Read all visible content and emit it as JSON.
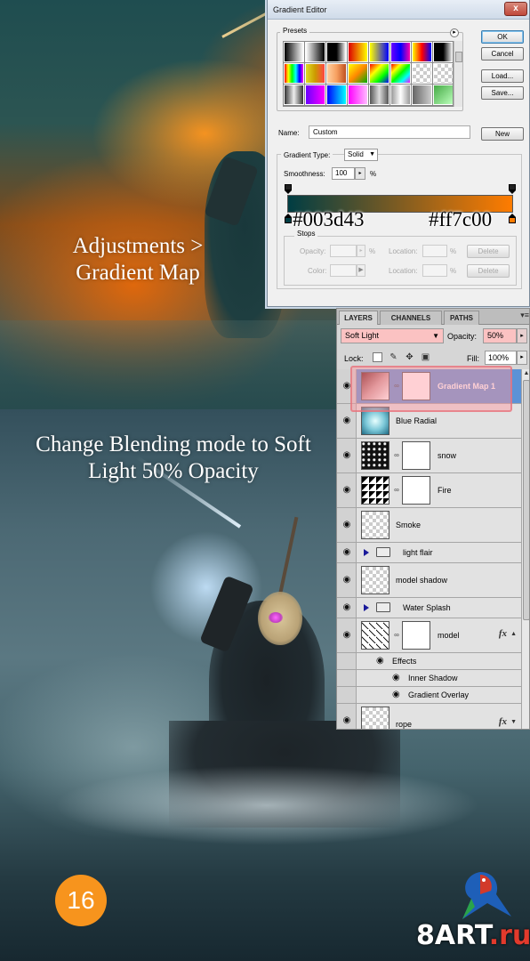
{
  "captions": {
    "top": "Adjustments > Gradient Map",
    "bottom": "Change Blending mode to Soft Light 50% Opacity"
  },
  "step_number": "16",
  "watermark": {
    "main": "8ART",
    "suffix": ".ru"
  },
  "colors": {
    "gradient_start": "#003d43",
    "gradient_end": "#ff7c00",
    "badge": "#f7941d",
    "blend_highlight": "#fbc2c2",
    "selected_layer": "#5b92d6"
  },
  "gradient_editor": {
    "title": "Gradient Editor",
    "close_glyph": "x",
    "presets_label": "Presets",
    "presets_menu_glyph": "▸",
    "buttons": {
      "ok": "OK",
      "cancel": "Cancel",
      "load": "Load...",
      "save": "Save...",
      "new": "New"
    },
    "name_label": "Name:",
    "name_value": "Custom",
    "gradient_type_label": "Gradient Type:",
    "gradient_type_value": "Solid",
    "smoothness_label": "Smoothness:",
    "smoothness_value": "100",
    "smoothness_unit": "%",
    "hex_left": "#003d43",
    "hex_right": "#ff7c00",
    "stops": {
      "label": "Stops",
      "opacity_label": "Opacity:",
      "color_label": "Color:",
      "location_label": "Location:",
      "unit": "%",
      "delete_label": "Delete"
    }
  },
  "layers_panel": {
    "tabs": [
      "LAYERS",
      "CHANNELS",
      "PATHS"
    ],
    "menu_glyph": "▾≡",
    "blend_mode": "Soft Light",
    "opacity_label": "Opacity:",
    "opacity_value": "50%",
    "lock_label": "Lock:",
    "fill_label": "Fill:",
    "fill_value": "100%",
    "layers": [
      {
        "name": "Gradient Map 1",
        "selected": true
      },
      {
        "name": "Blue Radial"
      },
      {
        "name": "snow"
      },
      {
        "name": "Fire"
      },
      {
        "name": "Smoke"
      },
      {
        "name": "light flair"
      },
      {
        "name": "model shadow"
      },
      {
        "name": "Water Splash"
      },
      {
        "name": "model",
        "fx": "fx"
      },
      {
        "name": "rope",
        "fx": "fx"
      }
    ],
    "effects": {
      "label": "Effects",
      "items": [
        "Inner Shadow",
        "Gradient Overlay"
      ]
    }
  },
  "icons": [
    "eye-icon",
    "link-icon",
    "folder-icon",
    "fx-icon",
    "lock-icon",
    "close-icon"
  ]
}
